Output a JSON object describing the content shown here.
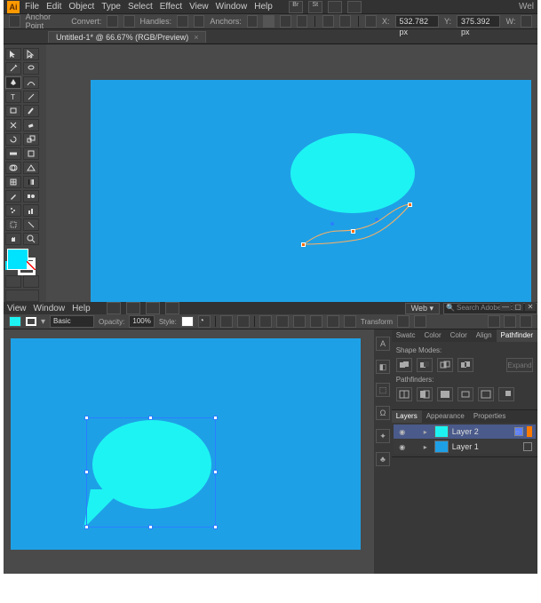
{
  "top": {
    "logo": "Ai",
    "menus": [
      "File",
      "Edit",
      "Object",
      "Type",
      "Select",
      "Effect",
      "View",
      "Window",
      "Help"
    ],
    "right_menu_extra1": "Br",
    "right_menu_extra2": "St",
    "right_text": "Wel",
    "ctrl": {
      "anchor_point": "Anchor Point",
      "convert": "Convert:",
      "handles": "Handles:",
      "anchors": "Anchors:",
      "x_label": "X:",
      "x_val": "532.782 px",
      "y_label": "Y:",
      "y_val": "375.392 px",
      "w_label": "W:"
    },
    "tab": {
      "title": "Untitled-1* @ 66.67% (RGB/Preview)",
      "close": "×"
    },
    "tool_names": [
      "selection",
      "direct-select",
      "magic-wand",
      "lasso",
      "pen",
      "curvature",
      "type",
      "line",
      "rectangle",
      "ellipse",
      "paintbrush",
      "pencil",
      "eraser",
      "rotate",
      "scale",
      "width",
      "free-transform",
      "shape-builder",
      "perspective",
      "mesh",
      "gradient",
      "eyedropper",
      "blend",
      "symbol-spray",
      "column-graph",
      "artboard",
      "slice",
      "hand",
      "zoom"
    ],
    "swatch_fill": "#00e3ff"
  },
  "bot": {
    "menus": [
      "View",
      "Window",
      "Help"
    ],
    "web_btn": "Web",
    "search_placeholder": "Search Adobe Stock",
    "winbtns": [
      "—",
      "▢",
      "✕"
    ],
    "ctrl": {
      "basic": "Basic",
      "opacity_lbl": "Opacity:",
      "opacity_val": "100%",
      "style_lbl": "Style:",
      "transform": "Transform"
    },
    "pathfinder": {
      "tabs": [
        "Swatc",
        "Color",
        "Color",
        "Align",
        "Pathfinder"
      ],
      "shape_modes": "Shape Modes:",
      "expand": "Expand",
      "pathfinders": "Pathfinders:"
    },
    "layers": {
      "tabs": [
        "Layers",
        "Appearance",
        "Properties"
      ],
      "rows": [
        {
          "name": "Layer 2",
          "selected": true,
          "thumb": "cyan"
        },
        {
          "name": "Layer 1",
          "selected": false,
          "thumb": "blue"
        }
      ]
    },
    "strip_icons": [
      "A",
      "◧",
      "⬚",
      "Ω",
      "✦",
      "♣"
    ]
  }
}
